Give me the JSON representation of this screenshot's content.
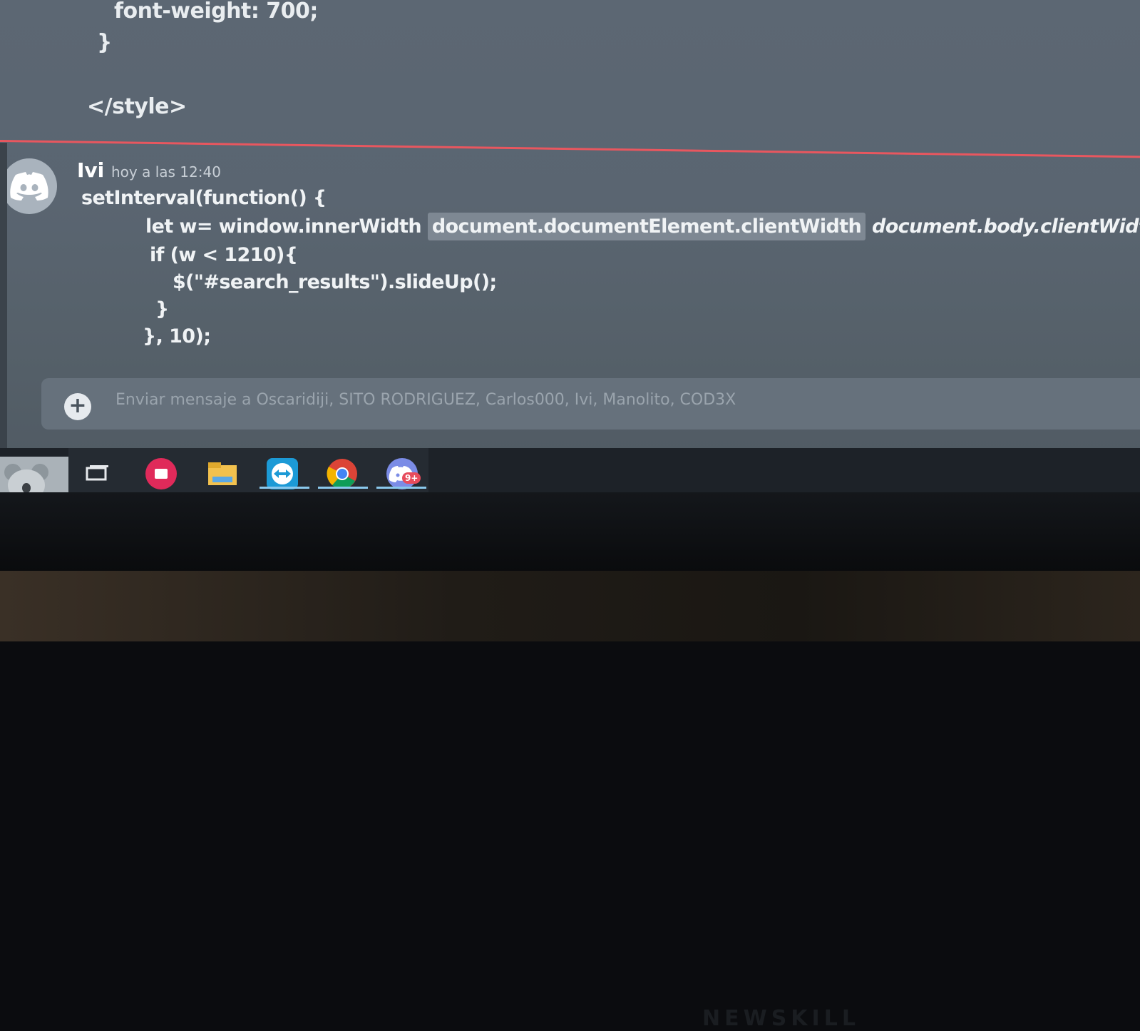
{
  "previous_message": {
    "lines": [
      "font-weight: 700;",
      "}",
      "</style>"
    ]
  },
  "message": {
    "author": "Ivi",
    "timestamp": "hoy a las 12:40",
    "line1": "setInterval(function() {",
    "line2_a": "let w= window.innerWidth",
    "line2_b": "document.documentElement.clientWidth",
    "line2_c": "document.body.clientWidth;",
    "line3": "if (w < 1210){",
    "line4": "$(\"#search_results\").slideUp();",
    "line5": "}",
    "line6": "}, 10);"
  },
  "composer": {
    "plus": "+",
    "placeholder": "Enviar mensaje a Oscaridiji, SITO RODRIGUEZ, Carlos000, Ivi, Manolito, COD3X"
  },
  "taskbar": {
    "icons": [
      "koala-wallpaper-icon",
      "task-view-icon",
      "app-red-icon",
      "file-explorer-icon",
      "teamviewer-icon",
      "chrome-icon",
      "discord-icon"
    ],
    "discord_badge": "9+"
  },
  "monitor": {
    "brand": "NEWSKILL"
  },
  "colors": {
    "divider": "#e8575f",
    "accent": "#5865f2"
  }
}
